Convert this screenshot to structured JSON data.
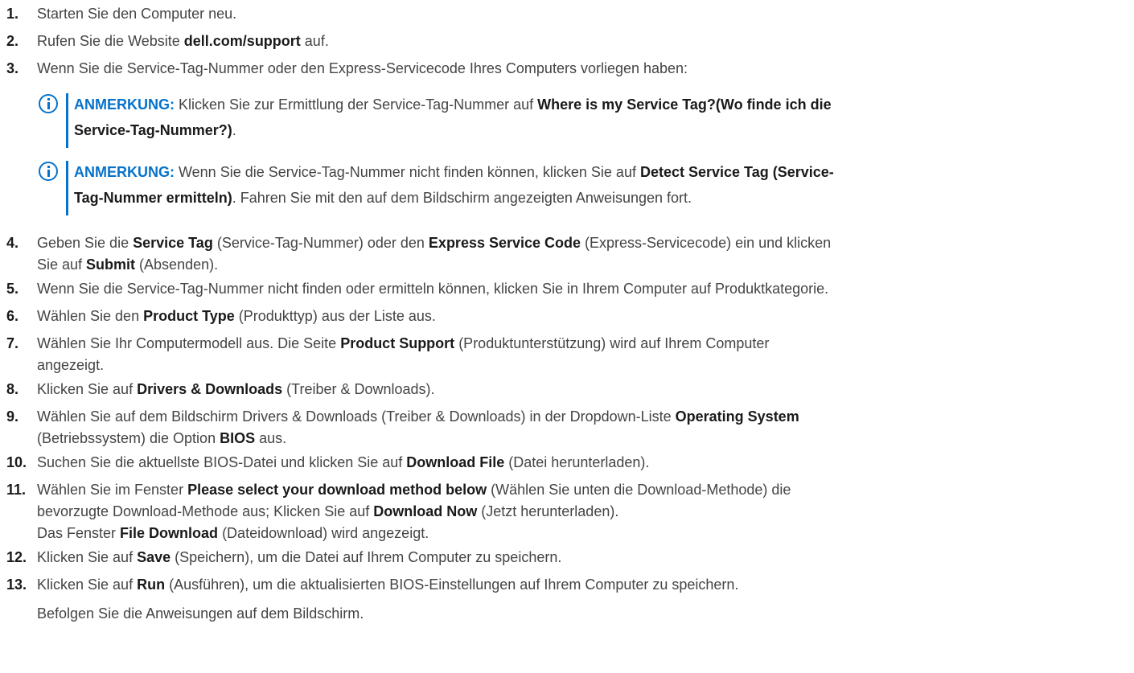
{
  "steps": [
    {
      "num": "1.",
      "lines": [
        [
          {
            "t": "Starten Sie den Computer neu."
          }
        ]
      ]
    },
    {
      "num": "2.",
      "lines": [
        [
          {
            "t": "Rufen Sie die Website "
          },
          {
            "t": "dell.com/support",
            "b": true
          },
          {
            "t": " auf."
          }
        ]
      ]
    },
    {
      "num": "3.",
      "lines": [
        [
          {
            "t": "Wenn Sie die Service-Tag-Nummer oder den Express-Servicecode Ihres Computers vorliegen haben:"
          }
        ]
      ]
    },
    {
      "num": "4.",
      "lines": [
        [
          {
            "t": "Geben Sie die "
          },
          {
            "t": "Service Tag",
            "b": true
          },
          {
            "t": " (Service-Tag-Nummer) oder den "
          },
          {
            "t": "Express Service Code",
            "b": true
          },
          {
            "t": " (Express-Servicecode) ein und klicken"
          }
        ],
        [
          {
            "t": "Sie auf "
          },
          {
            "t": "Submit",
            "b": true
          },
          {
            "t": " (Absenden)."
          }
        ]
      ]
    },
    {
      "num": "5.",
      "lines": [
        [
          {
            "t": "Wenn Sie die Service-Tag-Nummer nicht finden oder ermitteln können, klicken Sie in Ihrem Computer auf Produktkategorie."
          }
        ]
      ]
    },
    {
      "num": "6.",
      "lines": [
        [
          {
            "t": "Wählen Sie den "
          },
          {
            "t": "Product Type",
            "b": true
          },
          {
            "t": " (Produkttyp) aus der Liste aus."
          }
        ]
      ]
    },
    {
      "num": "7.",
      "lines": [
        [
          {
            "t": "Wählen Sie Ihr Computermodell aus. Die Seite "
          },
          {
            "t": "Product Support",
            "b": true
          },
          {
            "t": " (Produktunterstützung) wird auf Ihrem Computer"
          }
        ],
        [
          {
            "t": "angezeigt."
          }
        ]
      ]
    },
    {
      "num": "8.",
      "lines": [
        [
          {
            "t": "Klicken Sie auf "
          },
          {
            "t": "Drivers & Downloads",
            "b": true
          },
          {
            "t": " (Treiber & Downloads)."
          }
        ]
      ]
    },
    {
      "num": "9.",
      "lines": [
        [
          {
            "t": "Wählen Sie auf dem Bildschirm Drivers & Downloads (Treiber & Downloads) in der Dropdown-Liste "
          },
          {
            "t": "Operating System",
            "b": true
          }
        ],
        [
          {
            "t": "(Betriebssystem) die Option "
          },
          {
            "t": "BIOS",
            "b": true
          },
          {
            "t": " aus."
          }
        ]
      ]
    },
    {
      "num": "10.",
      "lines": [
        [
          {
            "t": "Suchen Sie die aktuellste BIOS-Datei und klicken Sie auf "
          },
          {
            "t": "Download File",
            "b": true
          },
          {
            "t": " (Datei herunterladen)."
          }
        ]
      ]
    },
    {
      "num": "11.",
      "lines": [
        [
          {
            "t": "Wählen Sie im Fenster "
          },
          {
            "t": "Please select your download method below",
            "b": true
          },
          {
            "t": " (Wählen Sie unten die Download-Methode) die"
          }
        ],
        [
          {
            "t": "bevorzugte Download-Methode aus; Klicken Sie auf "
          },
          {
            "t": "Download Now",
            "b": true
          },
          {
            "t": " (Jetzt herunterladen)."
          }
        ],
        [
          {
            "t": "Das Fenster "
          },
          {
            "t": "File Download",
            "b": true
          },
          {
            "t": " (Dateidownload) wird angezeigt."
          }
        ]
      ]
    },
    {
      "num": "12.",
      "lines": [
        [
          {
            "t": "Klicken Sie auf "
          },
          {
            "t": "Save",
            "b": true
          },
          {
            "t": " (Speichern), um die Datei auf Ihrem Computer zu speichern."
          }
        ]
      ]
    },
    {
      "num": "13.",
      "lines": [
        [
          {
            "t": "Klicken Sie auf "
          },
          {
            "t": "Run",
            "b": true
          },
          {
            "t": " (Ausführen), um die aktualisierten BIOS-Einstellungen auf Ihrem Computer zu speichern."
          }
        ]
      ]
    }
  ],
  "notes": [
    {
      "label": "ANMERKUNG:",
      "lines": [
        [
          {
            "t": " Klicken Sie zur Ermittlung der Service-Tag-Nummer auf "
          },
          {
            "t": "Where is my Service Tag?(Wo finde ich die",
            "b": true
          }
        ],
        [
          {
            "t": "Service-Tag-Nummer?)",
            "b": true
          },
          {
            "t": "."
          }
        ]
      ]
    },
    {
      "label": "ANMERKUNG:",
      "lines": [
        [
          {
            "t": " Wenn Sie die Service-Tag-Nummer nicht finden können, klicken Sie auf "
          },
          {
            "t": "Detect Service Tag (Service-",
            "b": true
          }
        ],
        [
          {
            "t": "Tag-Nummer ermitteln)",
            "b": true
          },
          {
            "t": ". Fahren Sie mit den auf dem Bildschirm angezeigten Anweisungen fort."
          }
        ]
      ]
    }
  ],
  "follow_up": "Befolgen Sie die Anweisungen auf dem Bildschirm."
}
